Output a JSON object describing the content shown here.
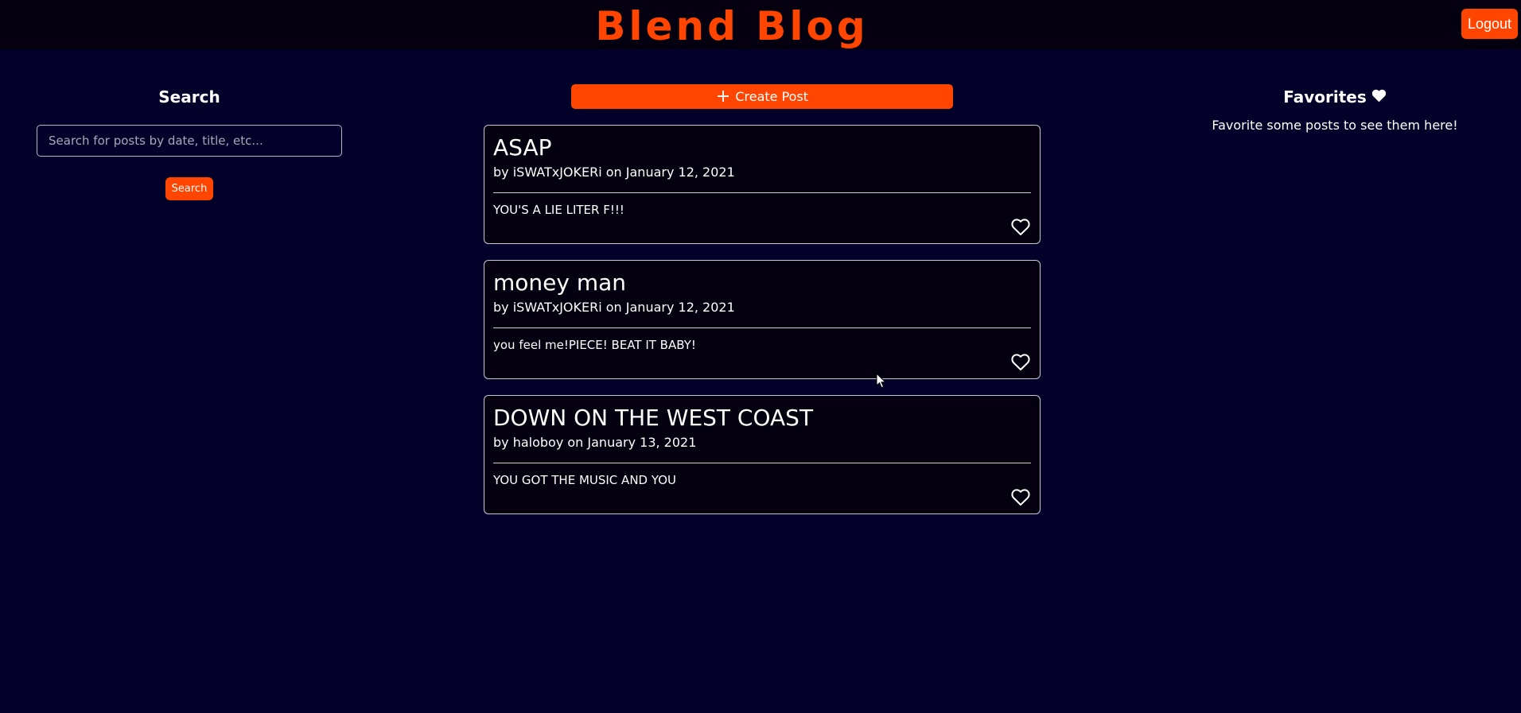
{
  "header": {
    "brand": "Blend Blog",
    "logout_label": "Logout"
  },
  "search": {
    "title": "Search",
    "placeholder": "Search for posts by date, title, etc...",
    "button_label": "Search"
  },
  "create_post": {
    "label": "Create Post",
    "icon": "plus-icon"
  },
  "posts": [
    {
      "title": "ASAP",
      "meta": "by iSWATxJOKERi on January 12, 2021",
      "body": "YOU'S A LIE LITER F!!!"
    },
    {
      "title": "money man",
      "meta": "by iSWATxJOKERi on January 12, 2021",
      "body": "you feel me!PIECE! BEAT IT BABY!"
    },
    {
      "title": "DOWN ON THE WEST COAST",
      "meta": "by haloboy on January 13, 2021",
      "body": "YOU GOT THE MUSIC AND YOU"
    }
  ],
  "favorites": {
    "title": "Favorites",
    "empty_message": "Favorite some posts to see them here!"
  },
  "colors": {
    "accent": "#ff4500",
    "background": "#03002a",
    "card": "#04000f"
  }
}
